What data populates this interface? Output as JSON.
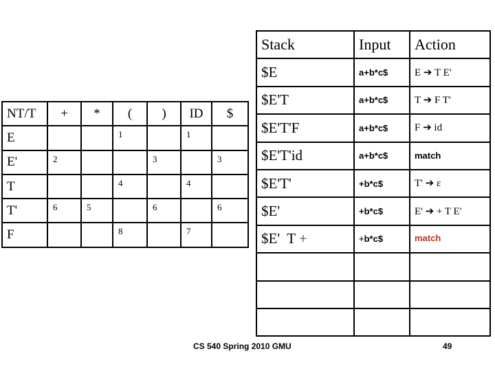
{
  "parsing_table": {
    "corner_label": "NT/T",
    "terminals": [
      "+",
      "*",
      "(",
      ")",
      "ID",
      "$"
    ],
    "rows": [
      {
        "nonterminal": "E",
        "cells": [
          "",
          "",
          "1",
          "",
          "1",
          ""
        ]
      },
      {
        "nonterminal": "E'",
        "cells": [
          "2",
          "",
          "",
          "3",
          "",
          "3"
        ]
      },
      {
        "nonterminal": "T",
        "cells": [
          "",
          "",
          "4",
          "",
          "4",
          ""
        ]
      },
      {
        "nonterminal": "T'",
        "cells": [
          "6",
          "5",
          "",
          "6",
          "",
          "6"
        ]
      },
      {
        "nonterminal": "F",
        "cells": [
          "",
          "",
          "8",
          "",
          "7",
          ""
        ]
      }
    ]
  },
  "trace_table": {
    "headers": {
      "stack": "Stack",
      "input": "Input",
      "action": "Action"
    },
    "rows": [
      {
        "stack": "$E",
        "stack_suffix": "",
        "input": "a+b*c$",
        "input_prefix": "",
        "action_lhs": "E",
        "arrow": "➔",
        "action_rhs": "T E'",
        "action_plain": "",
        "highlight": false
      },
      {
        "stack": "$E'T",
        "stack_suffix": "",
        "input": "a+b*c$",
        "input_prefix": "",
        "action_lhs": "T",
        "arrow": "➔",
        "action_rhs": "F T'",
        "action_plain": "",
        "highlight": false
      },
      {
        "stack": "$E'T'F",
        "stack_suffix": "",
        "input": "a+b*c$",
        "input_prefix": "",
        "action_lhs": "F",
        "arrow": "➔",
        "action_rhs": "id",
        "action_plain": "",
        "highlight": false
      },
      {
        "stack": "$E'T'id",
        "stack_suffix": "",
        "input": "a+b*c$",
        "input_prefix": "",
        "action_lhs": "",
        "arrow": "",
        "action_rhs": "",
        "action_plain": "match",
        "highlight": false
      },
      {
        "stack": "$E'T'",
        "stack_suffix": "",
        "input": "+b*c$",
        "input_prefix": "",
        "action_lhs": "T'",
        "arrow": "➔",
        "action_rhs": "ε",
        "action_plain": "",
        "highlight": false
      },
      {
        "stack": "$E'",
        "stack_suffix": "",
        "input": "+b*c$",
        "input_prefix": "",
        "action_lhs": "E'",
        "arrow": "➔",
        "action_rhs": "+ T E'",
        "action_plain": "",
        "highlight": false
      },
      {
        "stack": "$E'  T ",
        "stack_suffix": "+",
        "input": "b*c$",
        "input_prefix": "+",
        "action_lhs": "",
        "arrow": "",
        "action_rhs": "",
        "action_plain": "match",
        "highlight": true
      },
      {
        "stack": "",
        "stack_suffix": "",
        "input": "",
        "input_prefix": "",
        "action_lhs": "",
        "arrow": "",
        "action_rhs": "",
        "action_plain": "",
        "highlight": false
      },
      {
        "stack": "",
        "stack_suffix": "",
        "input": "",
        "input_prefix": "",
        "action_lhs": "",
        "arrow": "",
        "action_rhs": "",
        "action_plain": "",
        "highlight": false
      },
      {
        "stack": "",
        "stack_suffix": "",
        "input": "",
        "input_prefix": "",
        "action_lhs": "",
        "arrow": "",
        "action_rhs": "",
        "action_plain": "",
        "highlight": false
      }
    ]
  },
  "footer": {
    "course": "CS 540 Spring 2010 GMU",
    "page_number": "49"
  },
  "colors": {
    "highlight_red": "#B03A20",
    "highlight_blue": "#333366",
    "border": "#000000",
    "background": "#FFFFFF"
  }
}
